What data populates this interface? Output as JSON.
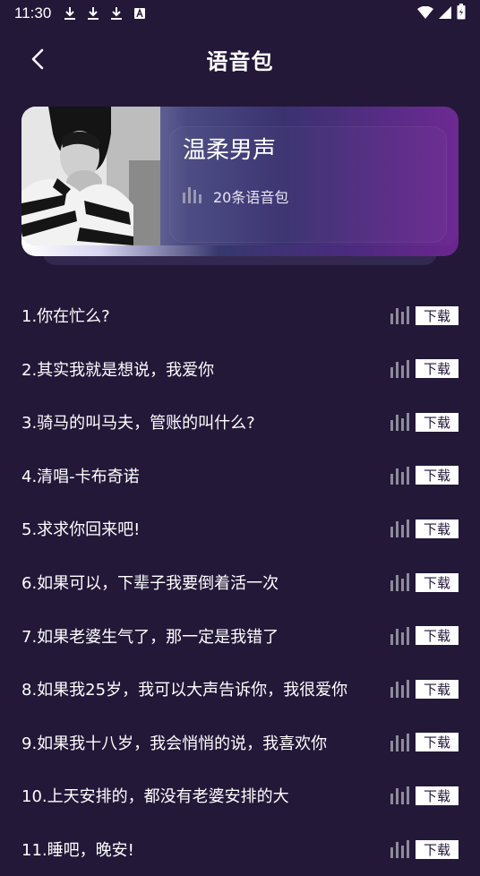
{
  "status_bar": {
    "time": "11:30"
  },
  "header": {
    "title": "语音包"
  },
  "card": {
    "title": "温柔男声",
    "count_label": "20条语音包"
  },
  "items": [
    {
      "title": "1.你在忙么?",
      "action": "下载"
    },
    {
      "title": "2.其实我就是想说，我爱你",
      "action": "下载"
    },
    {
      "title": "3.骑马的叫马夫，管账的叫什么?",
      "action": "下载"
    },
    {
      "title": "4.清唱-卡布奇诺",
      "action": "下载"
    },
    {
      "title": "5.求求你回来吧!",
      "action": "下载"
    },
    {
      "title": "6.如果可以，下辈子我要倒着活一次",
      "action": "下载"
    },
    {
      "title": "7.如果老婆生气了，那一定是我错了",
      "action": "下载"
    },
    {
      "title": "8.如果我25岁，我可以大声告诉你，我很爱你",
      "action": "下载"
    },
    {
      "title": "9.如果我十八岁，我会悄悄的说，我喜欢你",
      "action": "下载"
    },
    {
      "title": "10.上天安排的，都没有老婆安排的大",
      "action": "下载"
    },
    {
      "title": "11.睡吧，晚安!",
      "action": "下载"
    }
  ]
}
